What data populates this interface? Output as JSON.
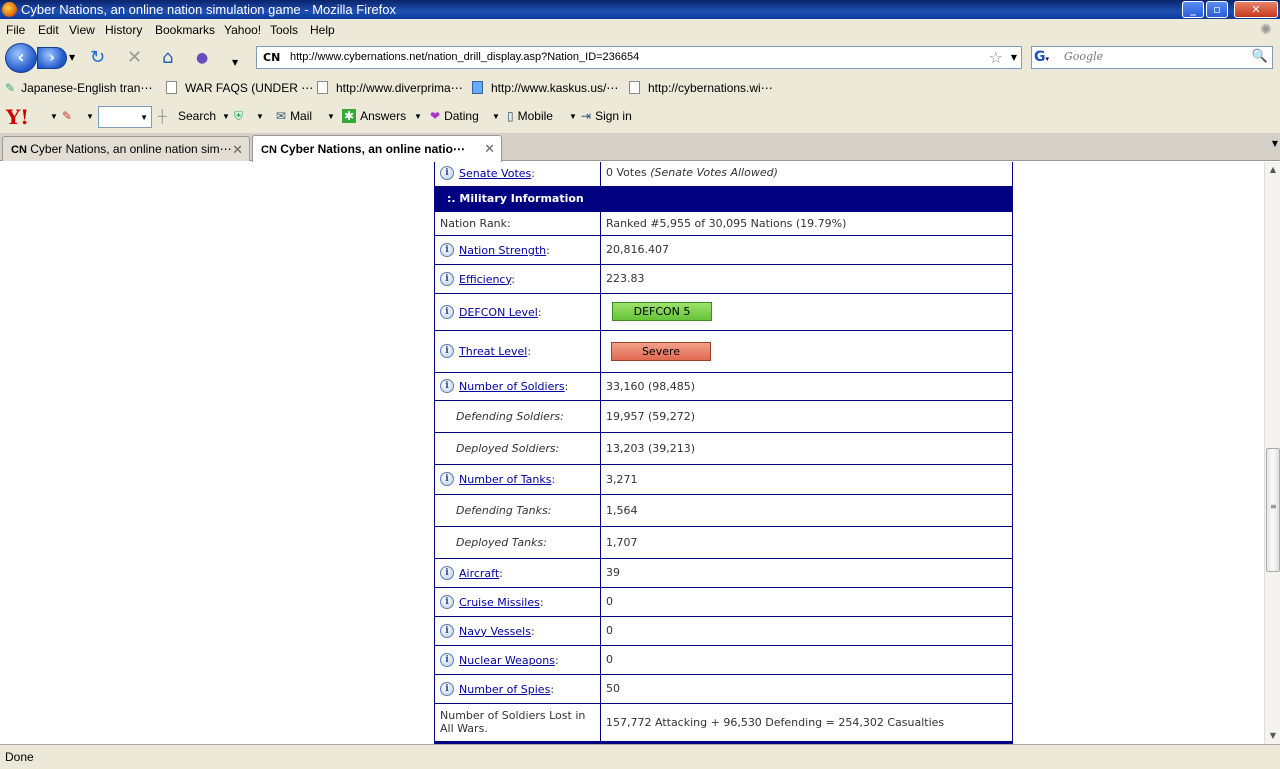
{
  "window": {
    "title": "Cyber Nations, an online nation simulation game - Mozilla Firefox"
  },
  "menu": [
    "File",
    "Edit",
    "View",
    "History",
    "Bookmarks",
    "Yahoo!",
    "Tools",
    "Help"
  ],
  "nav": {
    "site_badge": "CN",
    "url": "http://www.cybernations.net/nation_drill_display.asp?Nation_ID=236654",
    "search_placeholder": "Google"
  },
  "bookmarks": [
    "Japanese-English tran⋯",
    "WAR FAQS (UNDER ⋯",
    "http://www.diverprima⋯",
    "http://www.kaskus.us/⋯",
    "http://cybernations.wi⋯"
  ],
  "yahoo_toolbar": {
    "logo": "Y!",
    "search": "Search",
    "mail": "Mail",
    "answers": "Answers",
    "dating": "Dating",
    "mobile": "Mobile",
    "signin": "Sign in"
  },
  "tabs": [
    {
      "badge": "CN",
      "label": "Cyber Nations, an online nation sim⋯"
    },
    {
      "badge": "CN",
      "label": "Cyber Nations, an online natio⋯"
    }
  ],
  "table": {
    "senate_votes_label": "Senate Votes",
    "senate_votes_value": "0 Votes",
    "senate_votes_note": "(Senate Votes Allowed)",
    "section_header": ":. Military Information",
    "rows": [
      {
        "label": "Nation Rank:",
        "value": "Ranked #5,955 of 30,095 Nations (19.79%)"
      },
      {
        "label": "Nation Strength",
        "value": "20,816.407"
      },
      {
        "label": "Efficiency",
        "value": "223.83"
      },
      {
        "label": "DEFCON Level",
        "value": "DEFCON 5"
      },
      {
        "label": "Threat Level",
        "value": "Severe"
      },
      {
        "label": "Number of Soldiers",
        "value": "33,160 (98,485)"
      },
      {
        "label": "Defending Soldiers:",
        "value": "19,957 (59,272)"
      },
      {
        "label": "Deployed Soldiers:",
        "value": "13,203 (39,213)"
      },
      {
        "label": "Number of Tanks",
        "value": "3,271"
      },
      {
        "label": "Defending Tanks:",
        "value": "1,564"
      },
      {
        "label": "Deployed Tanks:",
        "value": "1,707"
      },
      {
        "label": "Aircraft",
        "value": "39"
      },
      {
        "label": "Cruise Missiles",
        "value": "0"
      },
      {
        "label": "Navy Vessels",
        "value": "0"
      },
      {
        "label": "Nuclear Weapons",
        "value": "0"
      },
      {
        "label": "Number of Spies",
        "value": "50"
      },
      {
        "label": "Number of Soldiers Lost in All Wars.",
        "value": "157,772 Attacking + 96,530 Defending = 254,302 Casualties"
      }
    ]
  },
  "status": "Done"
}
